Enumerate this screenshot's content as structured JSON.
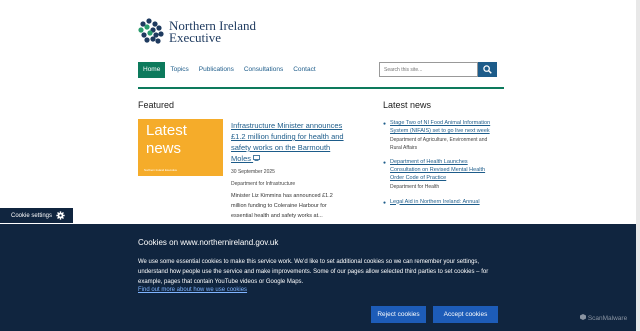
{
  "header": {
    "logo_line1": "Northern Ireland",
    "logo_line2": "Executive"
  },
  "nav": {
    "items": [
      "Home",
      "Topics",
      "Publications",
      "Consultations",
      "Contact"
    ]
  },
  "search": {
    "placeholder": "Search this site..."
  },
  "featured": {
    "heading": "Featured",
    "image_line1": "Latest",
    "image_line2": "news",
    "image_footer": "Northern Ireland Executive",
    "link": "Infrastructure Minister announces £1.2 million funding for health and safety works on the Barmouth Moles",
    "date": "30 September 2025",
    "org": "Department for Infrastructure",
    "summary": "Minister Liz Kimmins has announced £1.2 million funding to Coleraine Harbour for essential health and safety works at..."
  },
  "latest_news": {
    "heading": "Latest news",
    "items": [
      {
        "title": "Stage Two of NI Food Animal Information System (NIFAIS) set to go live next week",
        "org": "Department of Agriculture, Environment and Rural Affairs"
      },
      {
        "title": "Department of Health Launches Consultation on Revised Mental Health Order Code of Practice",
        "org": "Department for Health"
      },
      {
        "title": "Legal Aid in Northern Ireland: Annual",
        "org": ""
      }
    ]
  },
  "cookie_tab": {
    "label": "Cookie settings"
  },
  "cookie_banner": {
    "title": "Cookies on www.northernireland.gov.uk",
    "body": "We use some essential cookies to make this service work. We'd like to set additional cookies so we can remember your settings, understand how people use the service and make improvements. Some of our pages allow selected third parties to set cookies – for example, pages that contain YouTube videos or Google Maps.",
    "more_link": "Find out more about how we use cookies",
    "reject_label": "Reject cookies",
    "accept_label": "Accept cookies"
  },
  "watermark": "ScanMalware",
  "colors": {
    "brand_green": "#0d7a5c",
    "link_blue": "#1d5c8a",
    "banner_bg": "#10253f",
    "button_blue": "#1d5cb8",
    "featured_orange": "#f5ac2a"
  }
}
